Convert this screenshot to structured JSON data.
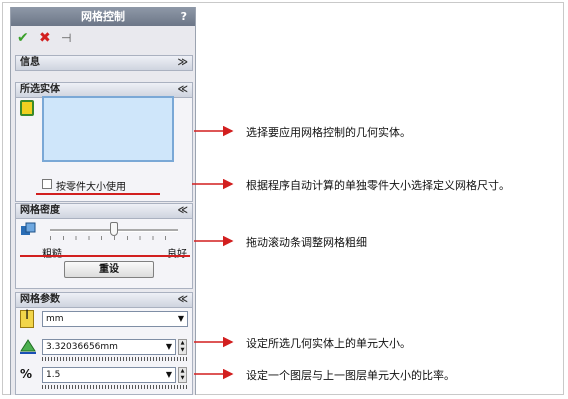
{
  "panel": {
    "title": "网格控制",
    "help": "?",
    "toolbar": {
      "ok": "✔",
      "cancel": "✖",
      "pin": "⊣"
    }
  },
  "sections": {
    "info": {
      "title": "信息",
      "chevron": "≫"
    },
    "selected": {
      "title": "所选实体",
      "chevron": "≪",
      "checkbox_label": "按零件大小使用"
    },
    "density": {
      "title": "网格密度",
      "chevron": "≪",
      "coarse": "粗糙",
      "fine": "良好",
      "reset_label": "重设",
      "slider_value": 0.5
    },
    "params": {
      "title": "网格参数",
      "chevron": "≪",
      "unit": "mm",
      "size_value": "3.32036656mm",
      "ratio_value": "1.5"
    }
  },
  "annotations": [
    "选择要应用网格控制的几何实体。",
    "根据程序自动计算的单独零件大小选择定义网格尺寸。",
    "拖动滚动条调整网格粗细",
    "设定所选几何实体上的单元大小。",
    "设定一个图层与上一图层单元大小的比率。"
  ],
  "colors": {
    "accent_red": "#d21f1f",
    "title_bar": "#6c7687",
    "listbox": "#cfe6fa"
  },
  "icons": {
    "ok": "green-check-icon",
    "cancel": "red-x-icon",
    "pin": "pushpin-icon"
  }
}
